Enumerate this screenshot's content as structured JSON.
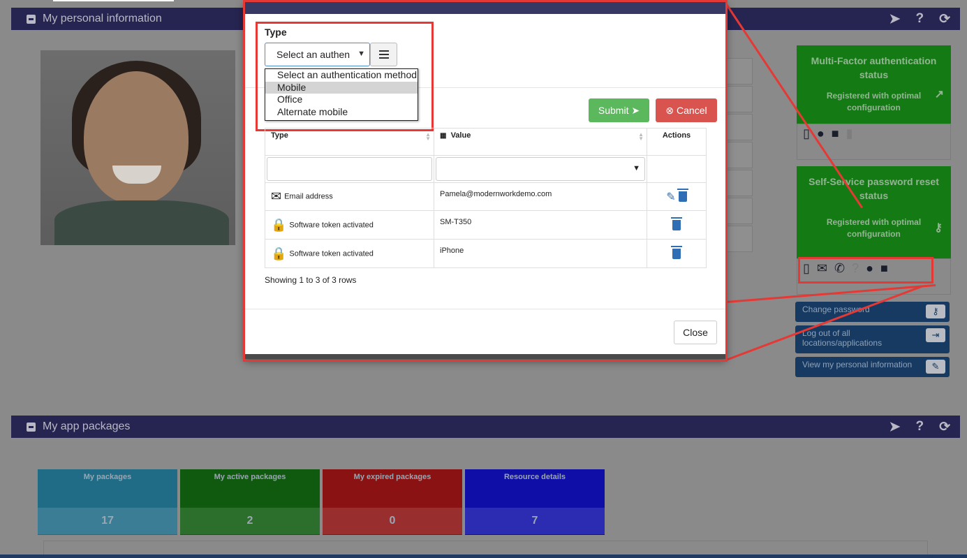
{
  "personal_panel": {
    "title": "My personal information"
  },
  "packages_panel": {
    "title": "My app packages"
  },
  "mfa_card": {
    "title": "Multi-Factor authentication status",
    "status": "Registered with optimal configuration"
  },
  "sspr_card": {
    "title": "Self-Service password reset status",
    "status": "Registered with optimal configuration"
  },
  "side_buttons": {
    "change_password": "Change password",
    "logout_all": "Log out of all locations/applications",
    "view_info": "View my personal information"
  },
  "tiles": [
    {
      "label": "My packages",
      "value": "17",
      "color": "#206b86"
    },
    {
      "label": "My active packages",
      "value": "2",
      "color": "#0f5a0f"
    },
    {
      "label": "My expired packages",
      "value": "0",
      "color": "#8a1212"
    },
    {
      "label": "Resource details",
      "value": "7",
      "color": "#0f0fa8"
    }
  ],
  "modal": {
    "type_label": "Type",
    "select_value": "Select an authen",
    "options": [
      "Select an authentication method",
      "Mobile",
      "Office",
      "Alternate mobile"
    ],
    "highlighted_option": "Mobile",
    "submit_label": "Submit",
    "cancel_label": "Cancel",
    "close_label": "Close",
    "table": {
      "headers": [
        "Type",
        "Value",
        "Actions"
      ],
      "rows": [
        {
          "type": "Email address",
          "value": "Pamela@modernworkdemo.com",
          "editable": true
        },
        {
          "type": "Software token activated",
          "value": "SM-T350",
          "editable": false
        },
        {
          "type": "Software token activated",
          "value": "iPhone",
          "editable": false
        }
      ],
      "footer": "Showing 1 to 3 of 3 rows"
    }
  },
  "colors": {
    "accent_red": "#e53935",
    "header_navy": "#262451",
    "card_green": "#147a14",
    "button_blue": "#173a63"
  }
}
